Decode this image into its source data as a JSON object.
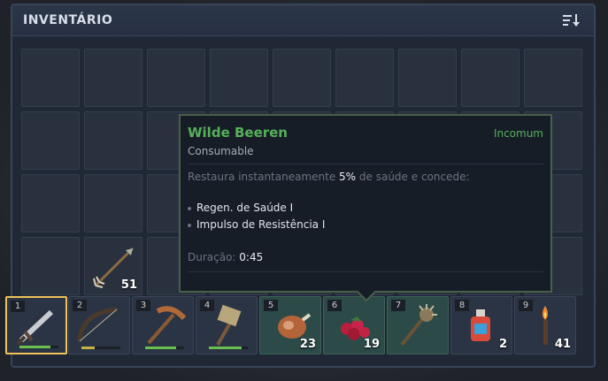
{
  "header": {
    "title": "INVENTÁRIO",
    "sort_icon": "sort-icon"
  },
  "inventory": {
    "arrows": {
      "icon": "arrow-icon",
      "count": "51"
    }
  },
  "hotbar": [
    {
      "key": "1",
      "icon": "sword-icon",
      "durability": 0.8,
      "selected": true
    },
    {
      "key": "2",
      "icon": "bow-icon",
      "durability": 0.35
    },
    {
      "key": "3",
      "icon": "pickaxe-icon",
      "durability": 0.8
    },
    {
      "key": "4",
      "icon": "stone-hammer-icon",
      "durability": 0.85
    },
    {
      "key": "5",
      "icon": "meat-icon",
      "count": "23"
    },
    {
      "key": "6",
      "icon": "berries-icon",
      "count": "19"
    },
    {
      "key": "7",
      "icon": "spiked-mace-icon"
    },
    {
      "key": "8",
      "icon": "potion-icon",
      "count": "2"
    },
    {
      "key": "9",
      "icon": "torch-icon",
      "count": "41"
    }
  ],
  "tooltip": {
    "name": "Wilde Beeren",
    "rarity": "Incomum",
    "type": "Consumable",
    "desc_pre": "Restaura instantaneamente ",
    "desc_value": "5%",
    "desc_post": " de saúde e concede:",
    "effects": [
      "Regen. de Saúde I",
      "Impulso de Resistência I"
    ],
    "duration_label": "Duração:",
    "duration_value": "0:45"
  },
  "colors": {
    "rarity": "#56b05a",
    "selected": "#f0c35a",
    "durability": "#69c04c"
  }
}
